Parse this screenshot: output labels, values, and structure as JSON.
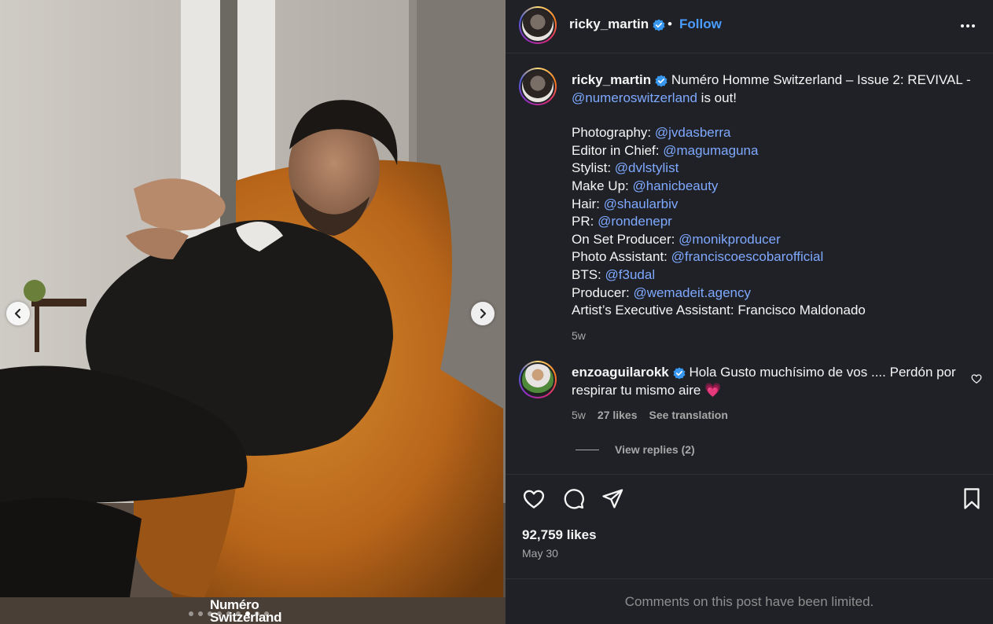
{
  "post": {
    "username": "ricky_martin",
    "separator": "•",
    "follow_label": "Follow",
    "caption": {
      "username": "ricky_martin",
      "first_line_text": "Numéro Homme Switzerland – Issue 2: REVIVAL -",
      "first_line_mention": "@numeroswitzerland",
      "first_line_tail": "is out!",
      "credits": [
        {
          "label": "Photography:",
          "mention": "@jvdasberra"
        },
        {
          "label": "Editor in Chief:",
          "mention": "@magumaguna"
        },
        {
          "label": "Stylist:",
          "mention": "@dvlstylist"
        },
        {
          "label": "Make Up:",
          "mention": "@hanicbeauty"
        },
        {
          "label": "Hair:",
          "mention": "@shaularbiv"
        },
        {
          "label": "PR:",
          "mention": "@rondenepr"
        },
        {
          "label": "On Set Producer:",
          "mention": "@monikproducer"
        },
        {
          "label": "Photo Assistant:",
          "mention": "@franciscoescobarofficial"
        },
        {
          "label": "BTS:",
          "mention": "@f3udal"
        },
        {
          "label": "Producer:",
          "mention": "@wemadeit.agency"
        },
        {
          "label": "Artist’s Executive Assistant: Francisco Maldonado",
          "mention": ""
        }
      ],
      "time": "5w"
    },
    "comment": {
      "username": "enzoaguilarokk",
      "text": "Hola Gusto muchísimo de vos .... Perdón por respirar tu mismo aire",
      "emoji": "💗",
      "time": "5w",
      "likes": "27 likes",
      "see_translation": "See translation",
      "view_replies": "View replies (2)"
    },
    "likes": "92,759 likes",
    "date": "May 30",
    "limited_notice": "Comments on this post have been limited."
  },
  "media": {
    "brand_line1": "Numéro",
    "brand_line2": "Switzerland",
    "dot_count": 9,
    "active_dot": 6
  },
  "colors": {
    "panel_bg": "#1f2127",
    "link": "#4a9cff",
    "mention": "#7fa9ff",
    "verified": "#3897f0",
    "chair": "#c7741e"
  }
}
